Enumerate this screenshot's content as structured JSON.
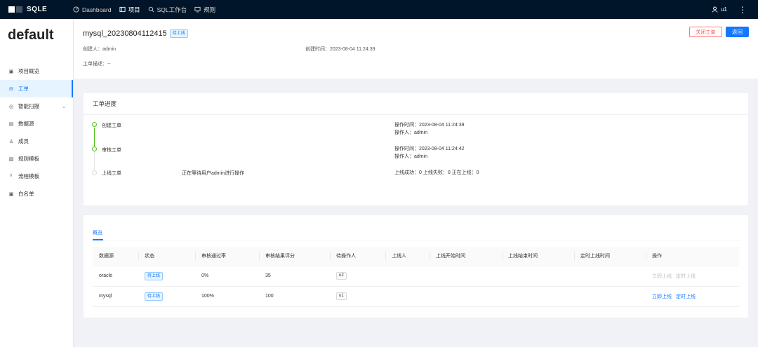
{
  "topbar": {
    "logo_text": "SQLE",
    "nav": [
      {
        "label": "Dashboard",
        "icon": "dashboard-icon"
      },
      {
        "label": "项目",
        "icon": "project-icon"
      },
      {
        "label": "SQL工作台",
        "icon": "search-icon"
      },
      {
        "label": "规则",
        "icon": "monitor-icon"
      }
    ],
    "user": "u1"
  },
  "sidebar": {
    "project": "default",
    "items": [
      {
        "label": "项目概览",
        "icon": "overview-icon"
      },
      {
        "label": "工单",
        "icon": "order-icon"
      },
      {
        "label": "智能扫描",
        "icon": "scan-icon"
      },
      {
        "label": "数据源",
        "icon": "database-icon"
      },
      {
        "label": "成员",
        "icon": "user-icon"
      },
      {
        "label": "规则模板",
        "icon": "template-icon"
      },
      {
        "label": "流程模板",
        "icon": "flow-icon"
      },
      {
        "label": "白名单",
        "icon": "whitelist-icon"
      }
    ]
  },
  "order": {
    "title": "mysql_20230804112415",
    "status": "待上线",
    "creator": "创建人：admin",
    "created_at": "创建时间：2023-08-04 11:24:39",
    "desc": "工单描述：--",
    "close_label": "关闭工单",
    "back_label": "返回"
  },
  "progress": {
    "title": "工单进度",
    "steps": [
      {
        "name": "创建工单",
        "extra": "",
        "line1": "操作时间：2023-08-04 11:24:39",
        "line2": "操作人：admin"
      },
      {
        "name": "审核工单",
        "extra": "",
        "line1": "操作时间：2023-08-04 11:24:42",
        "line2": "操作人：admin"
      },
      {
        "name": "上线工单",
        "extra": "正在等待用户admin进行操作",
        "line1": "上线成功：0  上线失败：0  正在上线：0",
        "line2": ""
      }
    ]
  },
  "overview": {
    "tab": "概览",
    "columns": [
      "数据源",
      "状态",
      "审核通过率",
      "审核结果评分",
      "待操作人",
      "上线人",
      "上线开始时间",
      "上线结束时间",
      "定时上线时间",
      "操作"
    ],
    "rows": [
      {
        "datasource": "oracle",
        "status": "待上线",
        "pass_rate": "0%",
        "score": "35",
        "operator": "u2",
        "executor": "",
        "start": "",
        "end": "",
        "scheduled": "",
        "action1": "立即上线",
        "action2": "定时上线"
      },
      {
        "datasource": "mysql",
        "status": "待上线",
        "pass_rate": "100%",
        "score": "100",
        "operator": "u1",
        "executor": "",
        "start": "",
        "end": "",
        "scheduled": "",
        "action1": "立即上线",
        "action2": "定时上线"
      }
    ]
  },
  "colors": {
    "accent": "#1677ff",
    "success": "#52c41a",
    "danger": "#ff4d4f",
    "nav_bg": "#001529"
  }
}
